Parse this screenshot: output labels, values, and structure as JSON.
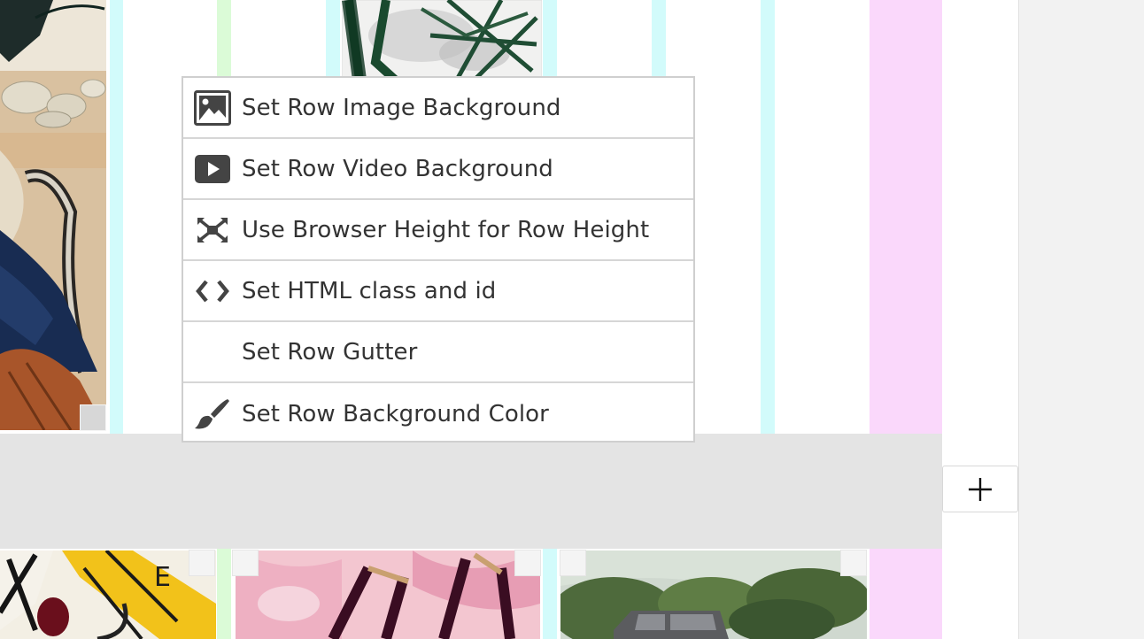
{
  "context_menu": {
    "items": [
      {
        "label": "Set Row Image Background",
        "icon": "image-icon"
      },
      {
        "label": "Set Row Video Background",
        "icon": "video-play-icon"
      },
      {
        "label": "Use Browser Height for Row Height",
        "icon": "expand-icon"
      },
      {
        "label": "Set HTML class and id",
        "icon": "code-brackets-icon"
      },
      {
        "label": "Set Row Gutter",
        "icon": ""
      },
      {
        "label": "Set Row Background Color",
        "icon": "paintbrush-icon"
      }
    ]
  },
  "canvas": {
    "guide_colors": {
      "cyan": "#d2fbfb",
      "green": "#dbfbd7",
      "pink": "#fad8fb"
    },
    "artwork_letter": "E"
  },
  "add_row": {
    "icon": "plus-icon"
  }
}
